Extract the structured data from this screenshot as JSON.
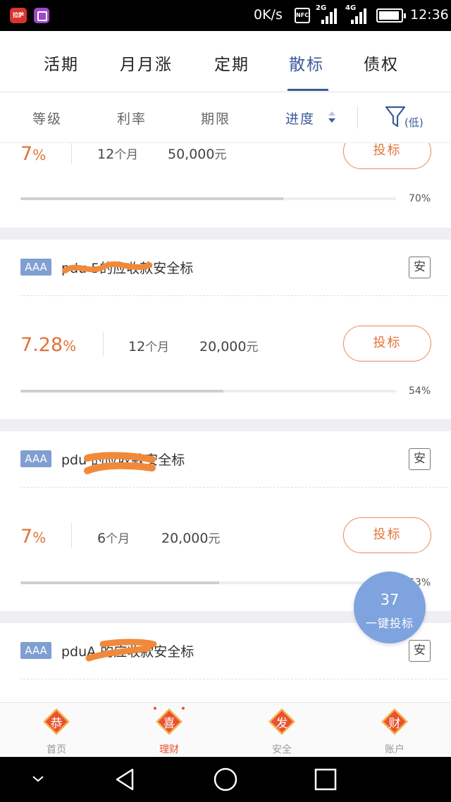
{
  "status_bar": {
    "app1_label": "拉萨",
    "speed": "0K/s",
    "nfc": "NFC",
    "net1": "2G",
    "net2": "4G",
    "time": "12:36"
  },
  "tabs": [
    {
      "label": "活期",
      "active": false
    },
    {
      "label": "月月涨",
      "active": false
    },
    {
      "label": "定期",
      "active": false
    },
    {
      "label": "散标",
      "active": true
    },
    {
      "label": "债权",
      "active": false
    }
  ],
  "filters": {
    "grade": "等级",
    "rate": "利率",
    "term": "期限",
    "progress": "进度",
    "low_label": "(低)"
  },
  "loans": [
    {
      "rate_int": "7",
      "rate_unit": "%",
      "term_num": "12",
      "term_unit": "个月",
      "amount": "50,000",
      "amount_unit": "元",
      "button": "投标",
      "progress_pct": 70,
      "progress_text": "70%"
    },
    {
      "badge": "AAA",
      "title": "pdu      5的应收款安全标",
      "safe_icon": "安",
      "rate_int": "7.28",
      "rate_unit": "%",
      "term_num": "12",
      "term_unit": "个月",
      "amount": "20,000",
      "amount_unit": "元",
      "button": "投标",
      "progress_pct": 54,
      "progress_text": "54%"
    },
    {
      "badge": "AAA",
      "title": "pdu       的应收款安全标",
      "safe_icon": "安",
      "rate_int": "7",
      "rate_unit": "%",
      "term_num": "6",
      "term_unit": "个月",
      "amount": "20,000",
      "amount_unit": "元",
      "button": "投标",
      "progress_pct": 53,
      "progress_text": "53%"
    },
    {
      "badge": "AAA",
      "title": "pduA      的应收款安全标",
      "safe_icon": "安"
    }
  ],
  "fab": {
    "count": "37",
    "label": "一键投标"
  },
  "bottom_nav": [
    {
      "glyph": "恭",
      "label": "首页",
      "active": false
    },
    {
      "glyph": "喜",
      "label": "理财",
      "active": true
    },
    {
      "glyph": "发",
      "label": "安全",
      "active": false
    },
    {
      "glyph": "财",
      "label": "账户",
      "active": false
    }
  ],
  "colors": {
    "accent_blue": "#3b5a99",
    "orange": "#e0743a",
    "badge_blue": "#7f9fd1",
    "fab_blue": "#7ea3de",
    "nav_red": "#e8522f"
  }
}
